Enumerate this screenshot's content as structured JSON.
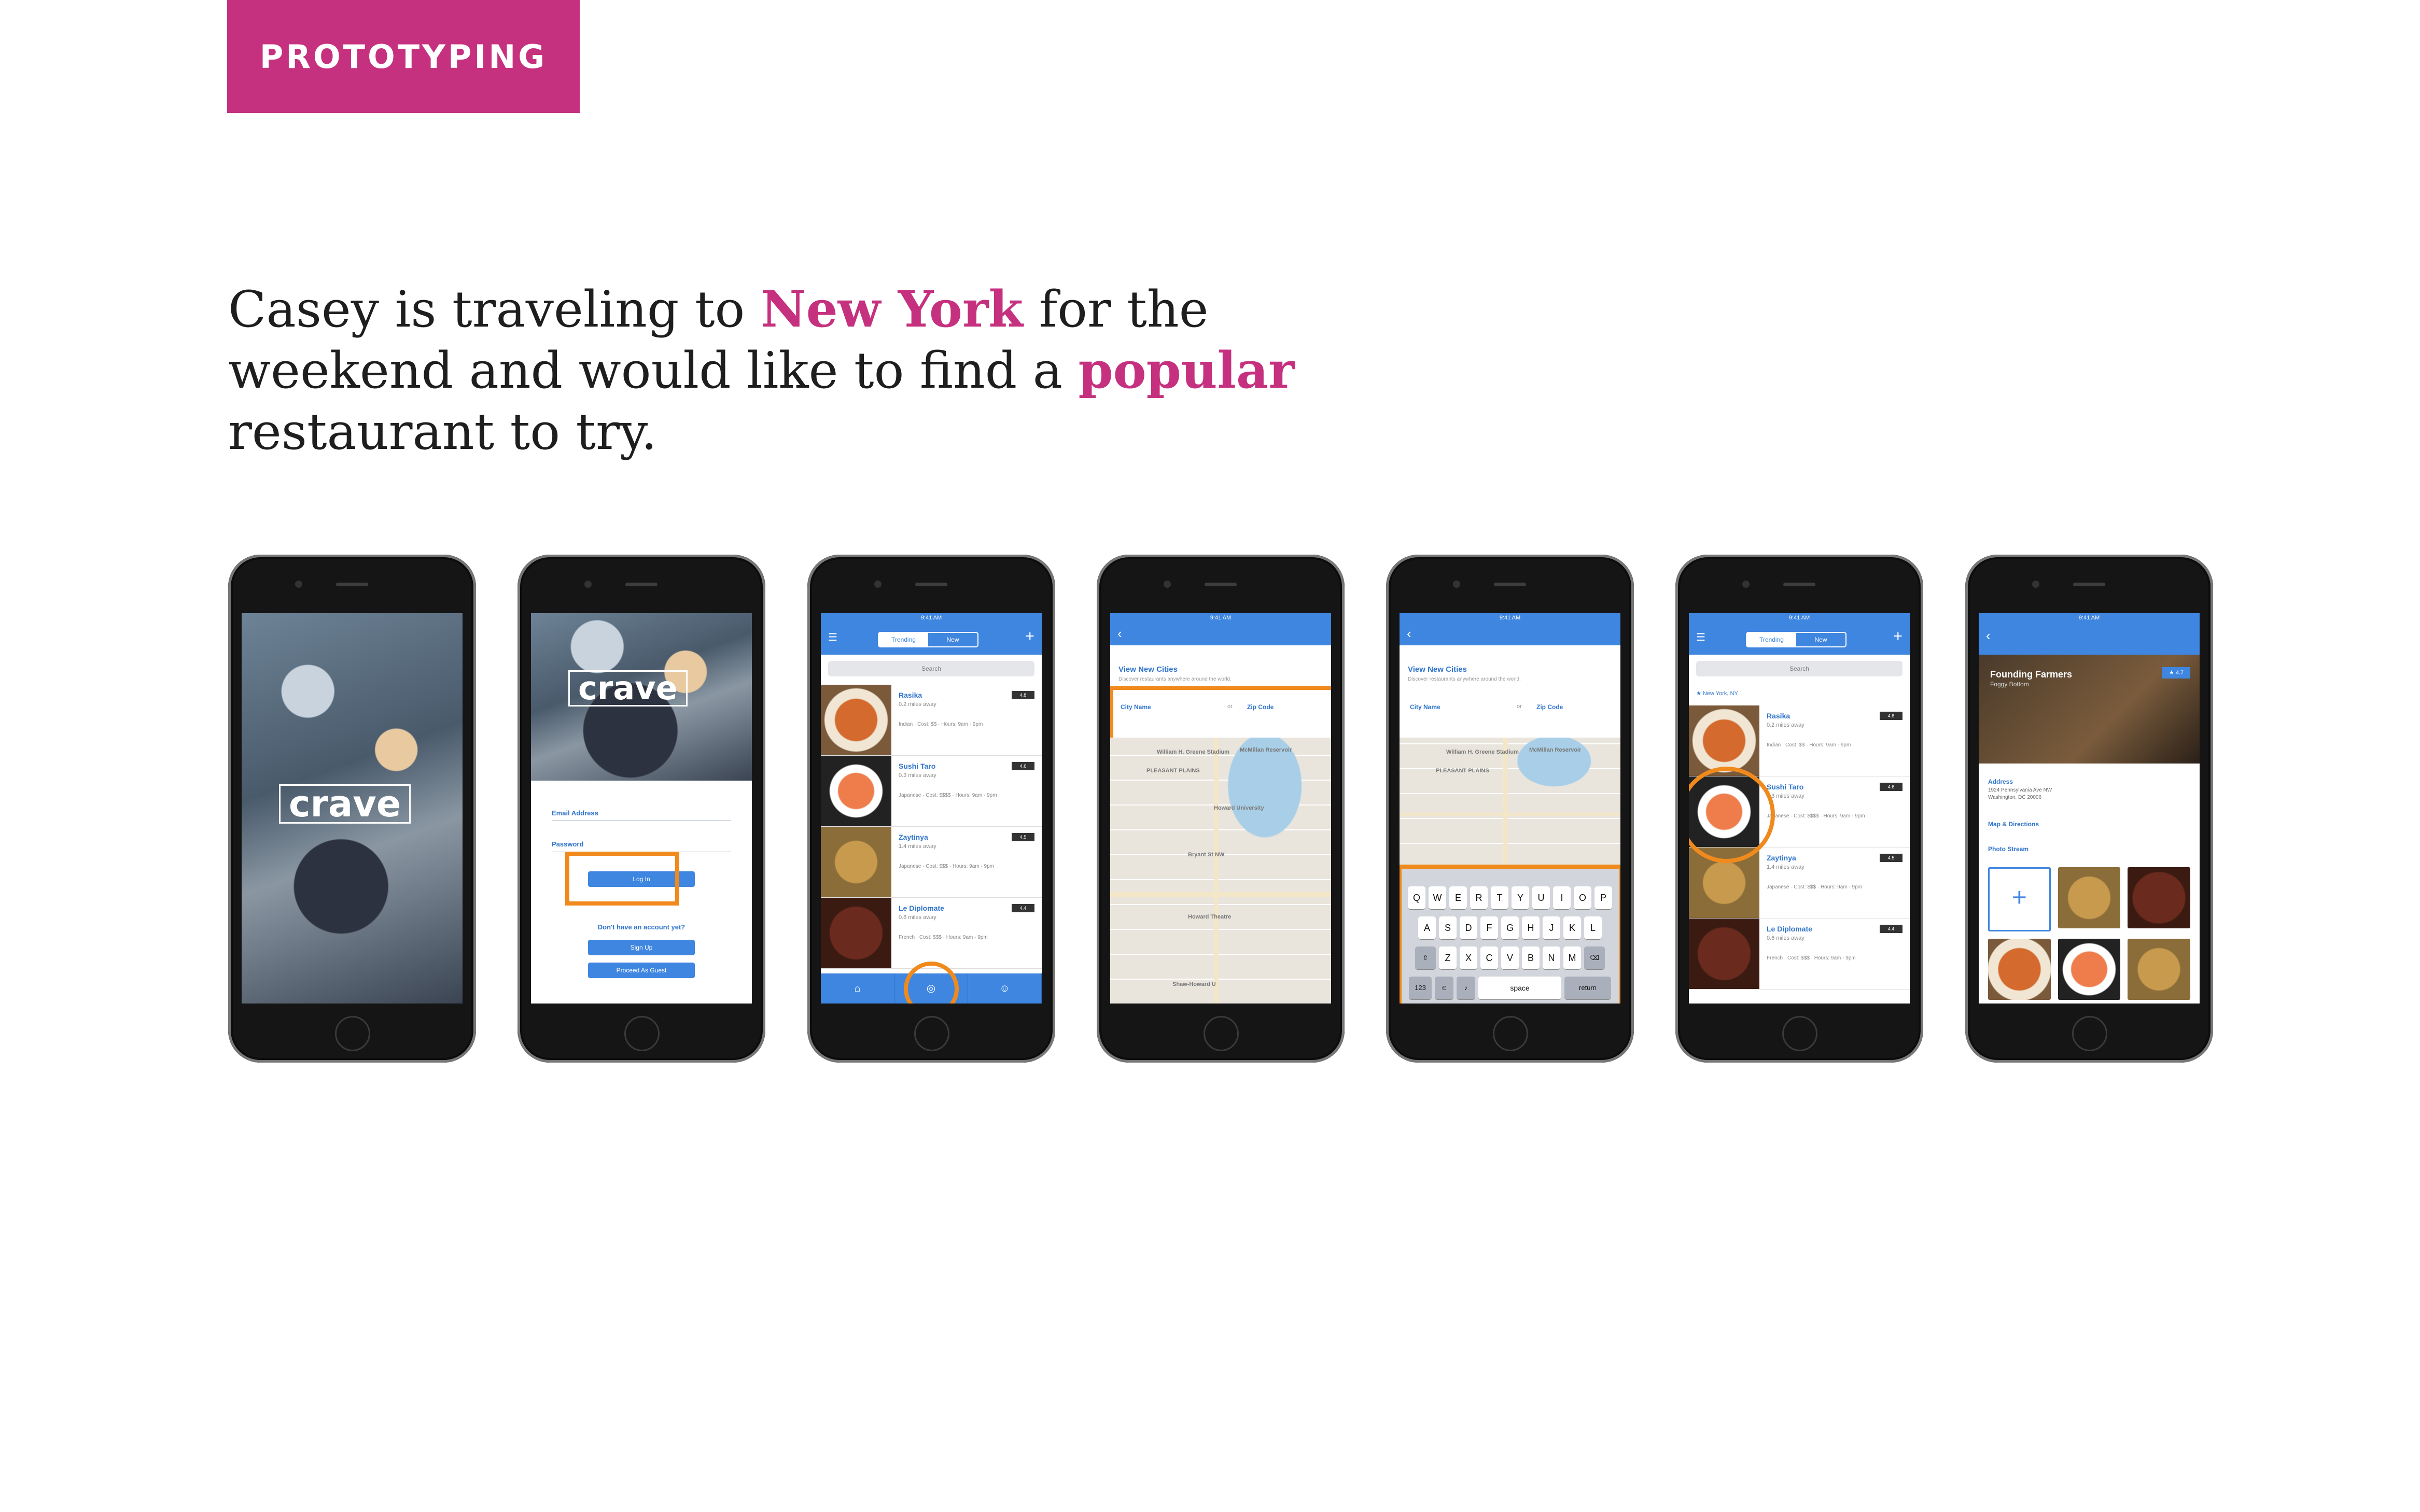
{
  "section_tag": "PROTOTYPING",
  "intro": {
    "part1": "Casey is traveling to ",
    "highlight1": "New York",
    "part2": " for the weekend and would like to find a ",
    "highlight2": "popular",
    "part3": " restaurant to try."
  },
  "colors": {
    "accent": "#c5317f",
    "app_blue": "#3f86e0",
    "highlight_ring": "#f08a1c"
  },
  "app": {
    "logo": "crave",
    "status_time": "9:41 AM",
    "login": {
      "email_label": "Email Address",
      "password_label": "Password",
      "login_button": "Log In",
      "no_account": "Don't have an account yet?",
      "signup_button": "Sign Up",
      "guest_button": "Proceed As Guest"
    },
    "tabs": {
      "trending": "Trending",
      "new": "New"
    },
    "search_placeholder": "Search",
    "location_chip": "New York, NY",
    "restaurants": [
      {
        "name": "Rasika",
        "distance": "0.2 miles away",
        "info": "Indian · Cost: $$ · Hours: 9am - 9pm",
        "rating": "4.8"
      },
      {
        "name": "Sushi Taro",
        "distance": "0.3 miles away",
        "info": "Japanese · Cost: $$$$ · Hours: 9am - 9pm",
        "rating": "4.6"
      },
      {
        "name": "Zaytinya",
        "distance": "1.4 miles away",
        "info": "Japanese · Cost: $$$ · Hours: 9am - 9pm",
        "rating": "4.5"
      },
      {
        "name": "Le Diplomate",
        "distance": "0.6 miles away",
        "info": "French · Cost: $$$ · Hours: 9am - 9pm",
        "rating": "4.4"
      }
    ],
    "cities": {
      "title": "View New Cities",
      "subtitle": "Discover restaurants anywhere around the world.",
      "city_field": "City Name",
      "or": "or",
      "zip_field": "Zip Code",
      "map_labels": [
        "PLEASANT PLAINS",
        "McMillan Reservoir",
        "William H. Greene Stadium",
        "Howard University",
        "Bryant St NW",
        "Howard Theatre",
        "Shaw-Howard U"
      ]
    },
    "keyboard": {
      "row1": [
        "Q",
        "W",
        "E",
        "R",
        "T",
        "Y",
        "U",
        "I",
        "O",
        "P"
      ],
      "row2": [
        "A",
        "S",
        "D",
        "F",
        "G",
        "H",
        "J",
        "K",
        "L"
      ],
      "row3": [
        "Z",
        "X",
        "C",
        "V",
        "B",
        "N",
        "M"
      ],
      "num": "123",
      "space": "space",
      "return": "return"
    },
    "detail": {
      "name": "Founding Farmers",
      "area": "Foggy Bottom",
      "score": "4.7",
      "address_label": "Address",
      "address_line1": "1924 Pennsylvania Ave NW",
      "address_line2": "Washington, DC 20006",
      "map_link": "Map & Directions",
      "photo_stream": "Photo Stream"
    }
  }
}
